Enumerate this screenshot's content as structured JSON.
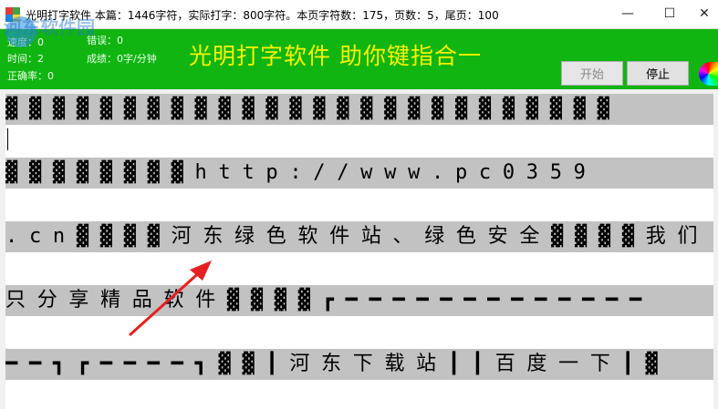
{
  "window": {
    "title": "光明打字软件  本篇：1446字符，实际打字：800字符。本页字符数：175，页数：5，尾页：100",
    "minimize_glyph": "—",
    "maximize_glyph": "☐",
    "close_glyph": "✕"
  },
  "stats": {
    "speed": "速度：0",
    "time": "时间：2",
    "accuracy": "正确率：0",
    "errors": "错误：0",
    "score": "成绩：0字/分钟"
  },
  "headline": "光明打字软件   助你键指合一",
  "buttons": {
    "start": "开始",
    "stop": "停止"
  },
  "lines": [
    "▓▓▓▓▓▓▓▓▓▓▓▓▓▓▓▓▓▓▓▓▓▓▓▓▓▓",
    "▓▓▓▓▓▓▓▓http://www.pc0359",
    ".cn▓▓▓▓河东绿色软件站、绿色安全▓▓▓▓我们",
    "只分享精品软件▓▓▓▓┏━━━━━━━━━━━━━",
    "━━┓┏━━━━┓▓▓┃河东下载站┃┃百度一下┃▓"
  ],
  "watermark": "河东软件园",
  "colors": {
    "header_green": "#11b511",
    "headline_yellow": "#f7f200",
    "source_bg": "#c2c2c2"
  }
}
